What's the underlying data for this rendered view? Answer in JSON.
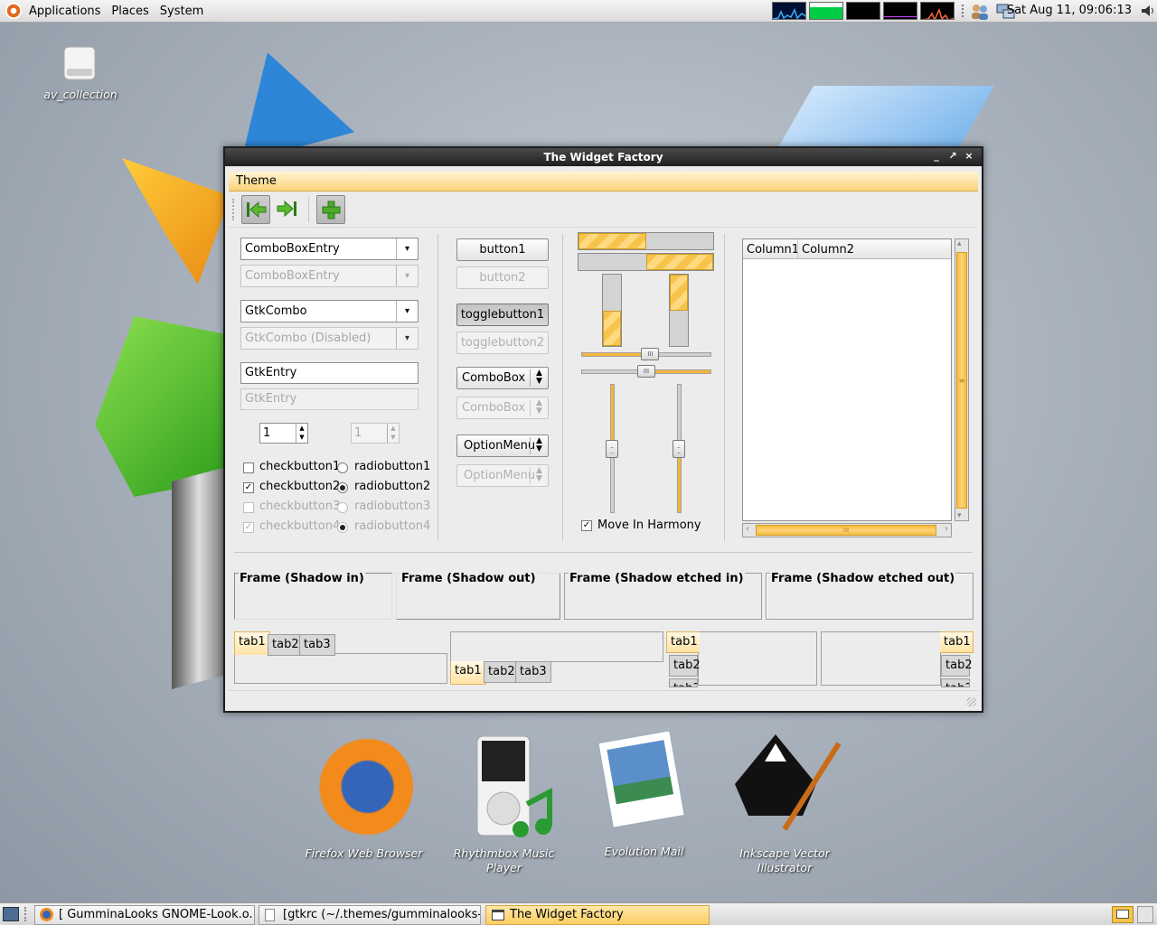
{
  "top_panel": {
    "menus": [
      "Applications",
      "Places",
      "System"
    ],
    "clock": "Sat Aug 11, 09:06:13"
  },
  "desktop": {
    "icons": {
      "av_collection": "av_collection",
      "firefox": "Firefox Web Browser",
      "rhythmbox_1": "Rhythmbox Music",
      "rhythmbox_2": "Player",
      "evolution": "Evolution Mail",
      "inkscape_1": "Inkscape Vector",
      "inkscape_2": "Illustrator"
    }
  },
  "window": {
    "title": "The Widget Factory",
    "menu": "Theme"
  },
  "left": {
    "combo_entry": "ComboBoxEntry",
    "combo_entry_dis": "ComboBoxEntry",
    "gtkcombo": "GtkCombo",
    "gtkcombo_dis": "GtkCombo (Disabled)",
    "entry": "GtkEntry",
    "entry_dis": "GtkEntry",
    "spin1": "1",
    "spin2": "1",
    "checks": [
      "checkbutton1",
      "checkbutton2",
      "checkbutton3",
      "checkbutton4"
    ],
    "radios": [
      "radiobutton1",
      "radiobutton2",
      "radiobutton3",
      "radiobutton4"
    ],
    "check_states": [
      false,
      true,
      false,
      true
    ],
    "radio_selected": "radiobutton2"
  },
  "middle": {
    "button1": "button1",
    "button2": "button2",
    "toggle1": "togglebutton1",
    "toggle2": "togglebutton2",
    "combobox": "ComboBox",
    "combobox_dis": "ComboBox",
    "optionmenu": "OptionMenu",
    "optionmenu_dis": "OptionMenu"
  },
  "progress": {
    "hbar1": 0.5,
    "hbar2": 0.5,
    "vbar1": 0.5,
    "vbar2": 0.5
  },
  "scales": {
    "hscale1": 0.53,
    "hscale2": 0.5,
    "vscale1": 0.5,
    "vscale2": 0.5,
    "harmony_label": "Move In Harmony",
    "harmony_checked": true
  },
  "tree": {
    "columns": [
      "Column1",
      "Column2"
    ]
  },
  "frames": [
    "Frame (Shadow in)",
    "Frame (Shadow out)",
    "Frame (Shadow etched in)",
    "Frame (Shadow etched out)"
  ],
  "tabs": [
    "tab1",
    "tab2",
    "tab3"
  ],
  "taskbar": {
    "tasks": [
      "[ GumminaLooks GNOME-Look.o...",
      "[gtkrc (~/.themes/gumminalooks-s...",
      "The Widget Factory"
    ]
  },
  "colors": {
    "accent": "#f7c44b",
    "panel": "#e8e8e8",
    "title_bar": "#2b2b2b"
  }
}
